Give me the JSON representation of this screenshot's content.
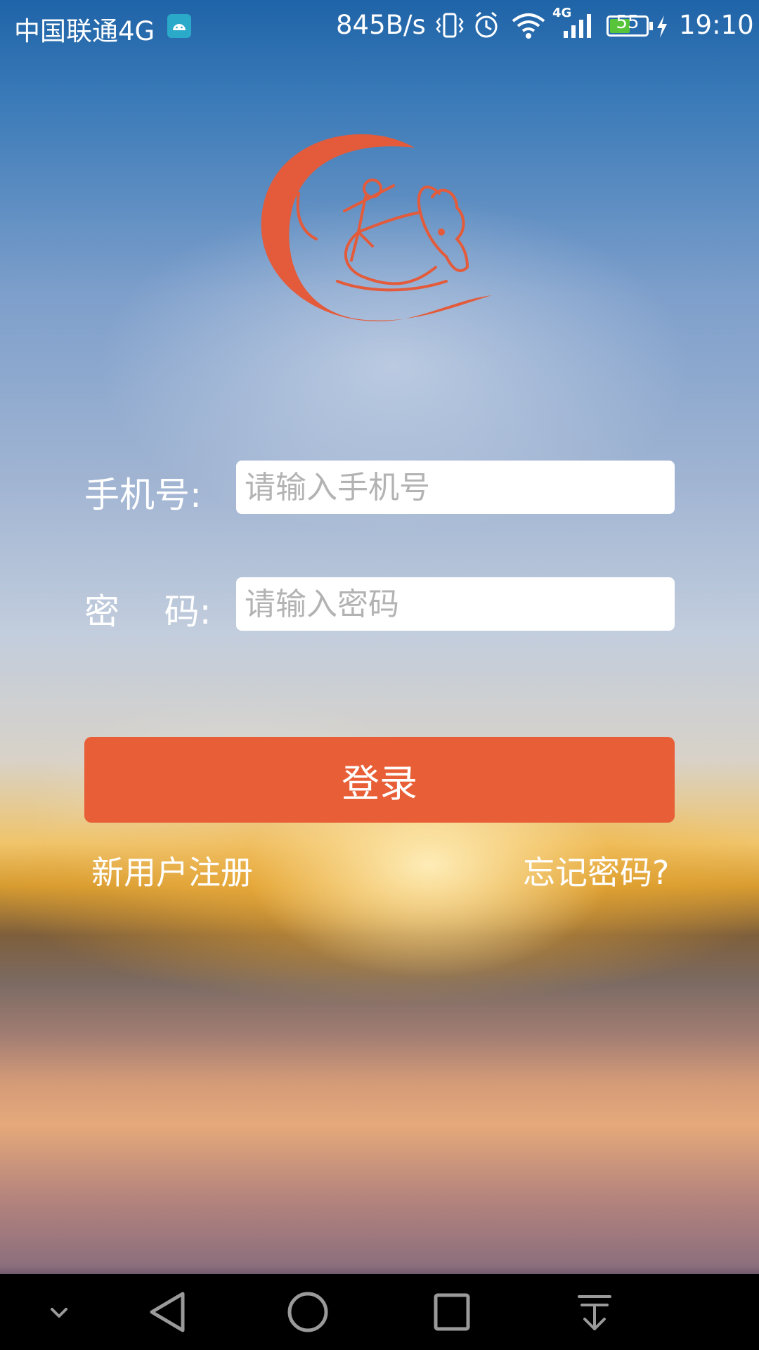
{
  "status_bar": {
    "carrier": "中国联通4G",
    "net_speed": "845B/s",
    "network_type": "4G",
    "battery_level": "55",
    "battery_fraction": 0.55,
    "time": "19:10"
  },
  "login_form": {
    "phone_label": "手机号:",
    "phone_placeholder": "请输入手机号",
    "password_label": "密    码:",
    "password_placeholder": "请输入密码",
    "login_button_label": "登录",
    "register_link": "新用户注册",
    "forgot_link": "忘记密码?"
  },
  "colors": {
    "accent": "#e85e37",
    "battery": "#58c43a"
  },
  "icons": {
    "logo": "ox-rider-logo",
    "nav": [
      "chevron-down-icon",
      "back-triangle-icon",
      "home-circle-icon",
      "recents-square-icon",
      "notification-pulldown-icon"
    ]
  }
}
